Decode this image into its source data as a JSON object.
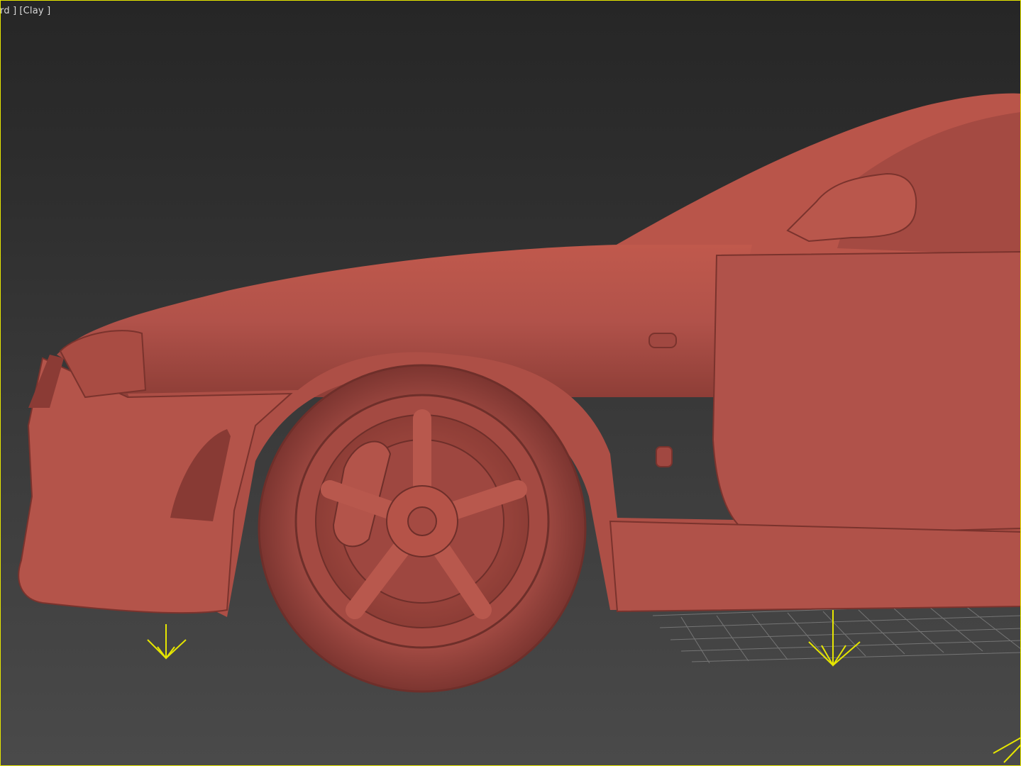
{
  "viewport": {
    "label_view": "rd ]",
    "label_shading": "[Clay ]",
    "border_color": "#e6e600",
    "clay_color": "#b55348",
    "gizmo_color": "#e6e600",
    "grid_color": "#8a8a8a"
  }
}
